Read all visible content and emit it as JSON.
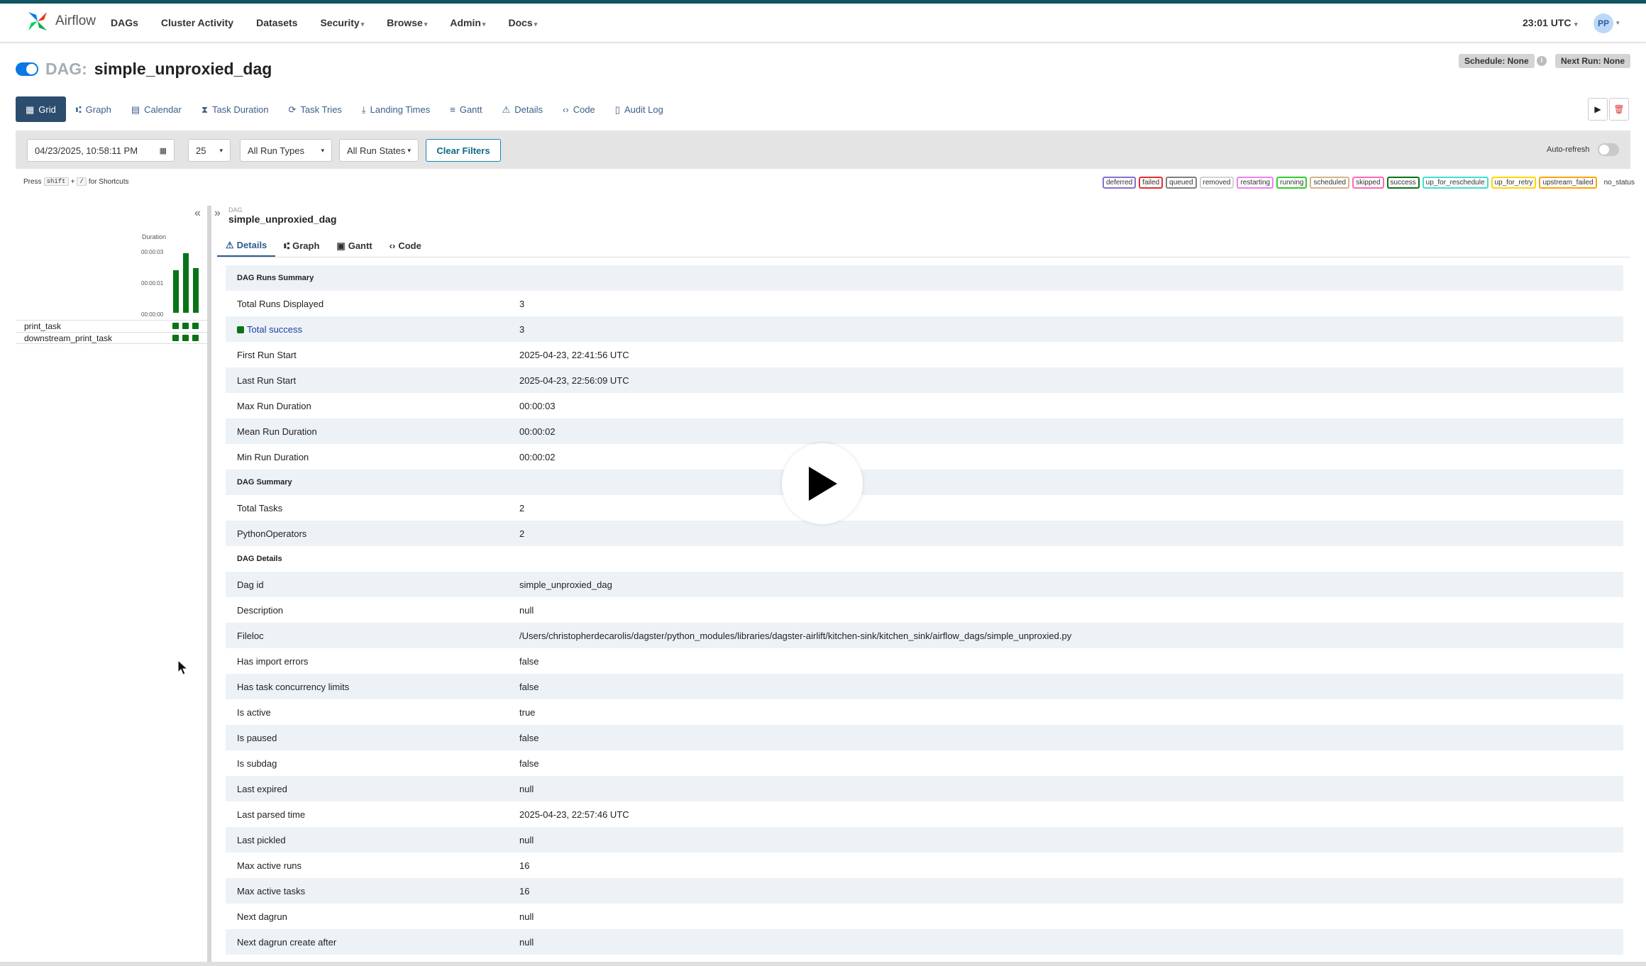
{
  "app": {
    "name": "Airflow"
  },
  "nav": [
    {
      "label": "DAGs",
      "caret": false
    },
    {
      "label": "Cluster Activity",
      "caret": false
    },
    {
      "label": "Datasets",
      "caret": false
    },
    {
      "label": "Security",
      "caret": true
    },
    {
      "label": "Browse",
      "caret": true
    },
    {
      "label": "Admin",
      "caret": true
    },
    {
      "label": "Docs",
      "caret": true
    }
  ],
  "clock": "23:01 UTC",
  "user_initials": "PP",
  "dag": {
    "prefix": "DAG:",
    "name": "simple_unproxied_dag"
  },
  "schedule": "Schedule: None",
  "next_run": "Next Run: None",
  "tabs": [
    {
      "label": "Grid",
      "icon": "grid-icon",
      "glyph": "▦",
      "active": true
    },
    {
      "label": "Graph",
      "icon": "graph-icon",
      "glyph": "⑆"
    },
    {
      "label": "Calendar",
      "icon": "calendar-icon",
      "glyph": "▤"
    },
    {
      "label": "Task Duration",
      "icon": "hourglass-icon",
      "glyph": "⧗"
    },
    {
      "label": "Task Tries",
      "icon": "retry-icon",
      "glyph": "⟳"
    },
    {
      "label": "Landing Times",
      "icon": "landing-icon",
      "glyph": "⤓"
    },
    {
      "label": "Gantt",
      "icon": "gantt-icon",
      "glyph": "≡"
    },
    {
      "label": "Details",
      "icon": "details-icon",
      "glyph": "⚠"
    },
    {
      "label": "Code",
      "icon": "code-icon",
      "glyph": "‹›"
    },
    {
      "label": "Audit Log",
      "icon": "audit-log-icon",
      "glyph": "▯"
    }
  ],
  "filters": {
    "date": "04/23/2025, 10:58:11 PM",
    "num_runs": "25",
    "run_types": "All Run Types",
    "run_states": "All Run States",
    "clear": "Clear Filters",
    "auto_refresh": "Auto-refresh"
  },
  "shortcuts": {
    "press": "Press",
    "key1": "shift",
    "plus": "+",
    "key2": "/",
    "suffix": "for Shortcuts"
  },
  "legend": [
    {
      "label": "deferred",
      "color": "#8a6fd1"
    },
    {
      "label": "failed",
      "color": "#e0312f"
    },
    {
      "label": "queued",
      "color": "#808080"
    },
    {
      "label": "removed",
      "color": "#d3d3d3"
    },
    {
      "label": "restarting",
      "color": "#ee82ee"
    },
    {
      "label": "running",
      "color": "#32cd32"
    },
    {
      "label": "scheduled",
      "color": "#d2b48c"
    },
    {
      "label": "skipped",
      "color": "#ff69b4"
    },
    {
      "label": "success",
      "color": "#0a7317"
    },
    {
      "label": "up_for_reschedule",
      "color": "#40e0d0"
    },
    {
      "label": "up_for_retry",
      "color": "#ffd700"
    },
    {
      "label": "upstream_failed",
      "color": "#ffa500"
    }
  ],
  "no_status": "no_status",
  "grid": {
    "duration_label": "Duration",
    "ticks": [
      "00:00:03",
      "00:00:01",
      "00:00:00"
    ],
    "runs_duration_fraction": [
      0.72,
      1.0,
      0.75
    ],
    "tasks": [
      "print_task",
      "downstream_print_task"
    ]
  },
  "panel": {
    "small": "DAG",
    "title": "simple_unproxied_dag"
  },
  "subtabs": [
    {
      "label": "Details",
      "glyph": "⚠",
      "icon": "details-icon",
      "active": true
    },
    {
      "label": "Graph",
      "glyph": "⑆",
      "icon": "graph-icon"
    },
    {
      "label": "Gantt",
      "glyph": "▣",
      "icon": "gantt-icon"
    },
    {
      "label": "Code",
      "glyph": "‹›",
      "icon": "code-icon"
    }
  ],
  "details": [
    {
      "k": "DAG Runs Summary",
      "section": true
    },
    {
      "k": "Total Runs Displayed",
      "v": "3"
    },
    {
      "k": "Total success",
      "v": "3",
      "success": true
    },
    {
      "k": "First Run Start",
      "v": "2025-04-23, 22:41:56 UTC"
    },
    {
      "k": "Last Run Start",
      "v": "2025-04-23, 22:56:09 UTC"
    },
    {
      "k": "Max Run Duration",
      "v": "00:00:03"
    },
    {
      "k": "Mean Run Duration",
      "v": "00:00:02"
    },
    {
      "k": "Min Run Duration",
      "v": "00:00:02"
    },
    {
      "k": "DAG Summary",
      "section": true
    },
    {
      "k": "Total Tasks",
      "v": "2"
    },
    {
      "k": "PythonOperators",
      "v": "2"
    },
    {
      "k": "DAG Details",
      "section": true
    },
    {
      "k": "Dag id",
      "v": "simple_unproxied_dag"
    },
    {
      "k": "Description",
      "v": "null"
    },
    {
      "k": "Fileloc",
      "v": "/Users/christopherdecarolis/dagster/python_modules/libraries/dagster-airlift/kitchen-sink/kitchen_sink/airflow_dags/simple_unproxied.py"
    },
    {
      "k": "Has import errors",
      "v": "false"
    },
    {
      "k": "Has task concurrency limits",
      "v": "false"
    },
    {
      "k": "Is active",
      "v": "true"
    },
    {
      "k": "Is paused",
      "v": "false"
    },
    {
      "k": "Is subdag",
      "v": "false"
    },
    {
      "k": "Last expired",
      "v": "null"
    },
    {
      "k": "Last parsed time",
      "v": "2025-04-23, 22:57:46 UTC"
    },
    {
      "k": "Last pickled",
      "v": "null"
    },
    {
      "k": "Max active runs",
      "v": "16"
    },
    {
      "k": "Max active tasks",
      "v": "16"
    },
    {
      "k": "Next dagrun",
      "v": "null"
    },
    {
      "k": "Next dagrun create after",
      "v": "null"
    }
  ]
}
